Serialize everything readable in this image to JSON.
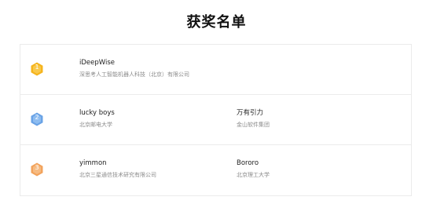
{
  "page": {
    "title": "获奖名单"
  },
  "winners": [
    {
      "rank": "1",
      "medal_color": "#f5b41d",
      "teams": [
        {
          "name": "iDeepWise",
          "org": "深思考人工智能机器人科技（北京）有限公司"
        }
      ]
    },
    {
      "rank": "2",
      "medal_color": "#6aa3e6",
      "teams": [
        {
          "name": "lucky boys",
          "org": "北京邮电大学"
        },
        {
          "name": "万有引力",
          "org": "金山软件集团"
        }
      ]
    },
    {
      "rank": "3",
      "medal_color": "#f2a35c",
      "teams": [
        {
          "name": "yimmon",
          "org": "北京三星通信技术研究有限公司"
        },
        {
          "name": "Bororo",
          "org": "北京理工大学"
        }
      ]
    }
  ]
}
